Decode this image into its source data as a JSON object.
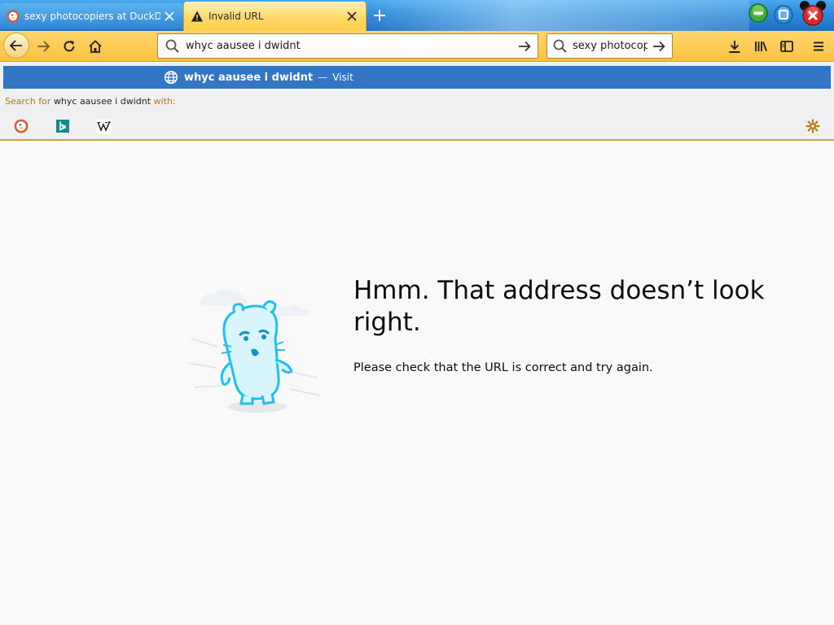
{
  "tabs": [
    {
      "title": "sexy photocopiers at DuckDuckGo",
      "active": false,
      "favicon": "duckduckgo-icon"
    },
    {
      "title": "Invalid URL",
      "active": true,
      "favicon": "warning-icon"
    }
  ],
  "window_controls": {
    "minimize": "minimize-icon",
    "maximize": "maximize-icon",
    "close": "close-icon"
  },
  "toolbar": {
    "url_value": "whyc aausee i dwidnt",
    "search_value": "sexy photocopiers"
  },
  "autocomplete": {
    "suggestion": "whyc aausee i dwidnt",
    "separator": "—",
    "action": "Visit",
    "search_for_prefix": "Search for",
    "search_for_term": "whyc aausee i dwidnt",
    "search_for_suffix": "with:",
    "engines": [
      "duckduckgo-icon",
      "bing-icon",
      "wikipedia-icon"
    ]
  },
  "error_page": {
    "title": "Hmm. That address doesn’t look right.",
    "description": "Please check that the URL is correct and try again."
  },
  "colors": {
    "tabstrip": "#2c8ad9",
    "toolbar": "#fbc140",
    "selection": "#3476c4",
    "page_bg": "#f9f9fa"
  }
}
